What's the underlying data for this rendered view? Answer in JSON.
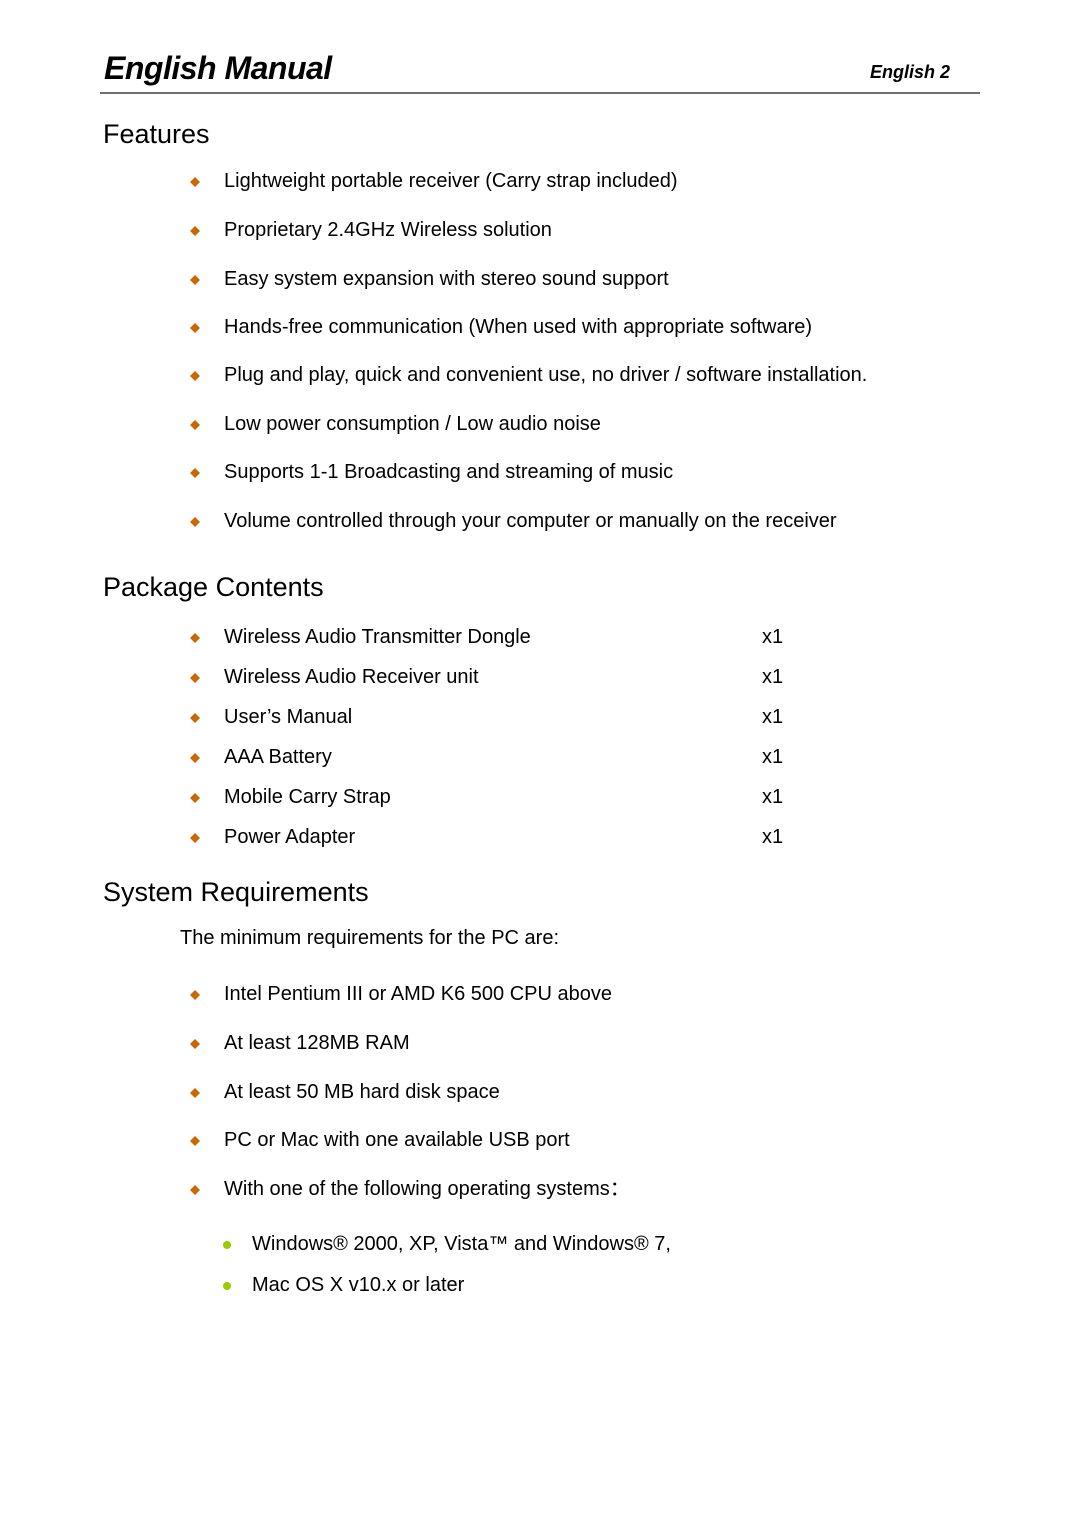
{
  "header": {
    "title": "English Manual",
    "page_label": "English  2"
  },
  "colors": {
    "bullet": "#cc6600",
    "sub_bullet": "#99cc00",
    "rule": "#6e6e6e"
  },
  "features": {
    "title": "Features",
    "items": [
      "Lightweight portable receiver (Carry strap included)",
      "Proprietary 2.4GHz Wireless solution",
      "Easy system expansion with stereo sound support",
      "Hands-free communication (When used with appropriate software)",
      "Plug and play, quick and convenient use, no driver / software installation.",
      "Low power consumption / Low audio noise",
      "Supports 1-1 Broadcasting and streaming of music",
      "Volume controlled through your computer or manually on the receiver"
    ]
  },
  "package": {
    "title": "Package Contents",
    "items": [
      {
        "name": "Wireless Audio Transmitter Dongle",
        "qty": "x1"
      },
      {
        "name": "Wireless Audio Receiver unit",
        "qty": "x1"
      },
      {
        "name": "User’s Manual",
        "qty": "x1"
      },
      {
        "name": "AAA Battery",
        "qty": "x1"
      },
      {
        "name": "Mobile Carry Strap",
        "qty": "x1"
      },
      {
        "name": "Power Adapter",
        "qty": "x1"
      }
    ]
  },
  "requirements": {
    "title": "System Requirements",
    "intro": "The minimum requirements for the PC are:",
    "items": [
      "Intel Pentium III or AMD K6 500 CPU above",
      "At least 128MB RAM",
      "At least 50 MB hard disk space",
      "PC or Mac with one available USB port",
      "With one of the following operating systems："
    ],
    "os": [
      "Windows® 2000, XP, Vista™ and Windows® 7,",
      "Mac OS X v10.x or later"
    ]
  }
}
